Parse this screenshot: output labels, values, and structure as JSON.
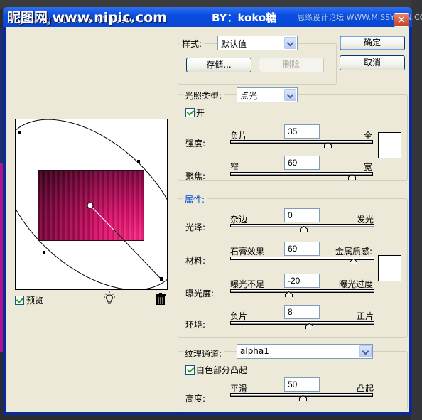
{
  "window": {
    "title": "Lighting Effects Classic",
    "watermark_left": "昵图网 www.nipic.com",
    "watermark_by": "BY：koko糖",
    "watermark_right": "思缘设计论坛 WWW.MISSYUAN.COM",
    "close_label": "✕"
  },
  "buttons": {
    "ok": "确定",
    "cancel": "取消",
    "save": "存储...",
    "delete": "删除"
  },
  "style": {
    "label": "样式:",
    "value": "默认值"
  },
  "light": {
    "type_label": "光照类型:",
    "type_value": "点光",
    "on_label": "开",
    "on_checked": true,
    "intensity": {
      "label": "强度:",
      "min_label": "负片",
      "max_label": "全",
      "value": "35",
      "fraction": 0.675
    },
    "focus": {
      "label": "聚焦:",
      "min_label": "窄",
      "max_label": "宽",
      "value": "69",
      "fraction": 0.845
    },
    "color": "#ffffff"
  },
  "properties": {
    "group_label": "属性:",
    "gloss": {
      "label": "光泽:",
      "min_label": "杂边",
      "max_label": "发光",
      "value": "0",
      "fraction": 0.5
    },
    "material": {
      "label": "材料:",
      "min_label": "石膏效果",
      "max_label": "金属质感:",
      "value": "69",
      "fraction": 0.845
    },
    "exposure": {
      "label": "曝光度:",
      "min_label": "曝光不足",
      "max_label": "曝光过度",
      "value": "-20",
      "fraction": 0.4
    },
    "ambience": {
      "label": "环境:",
      "min_label": "负片",
      "max_label": "正片",
      "value": "8",
      "fraction": 0.54
    },
    "color": "#ffffff"
  },
  "texture": {
    "channel_label": "纹理通道:",
    "channel_value": "alpha1",
    "white_high_label": "白色部分凸起",
    "white_high_checked": true,
    "height": {
      "label": "高度:",
      "min_label": "平滑",
      "max_label": "凸起",
      "value": "50",
      "fraction": 0.5
    }
  },
  "preview": {
    "checkbox_label": "预览",
    "checked": true
  }
}
